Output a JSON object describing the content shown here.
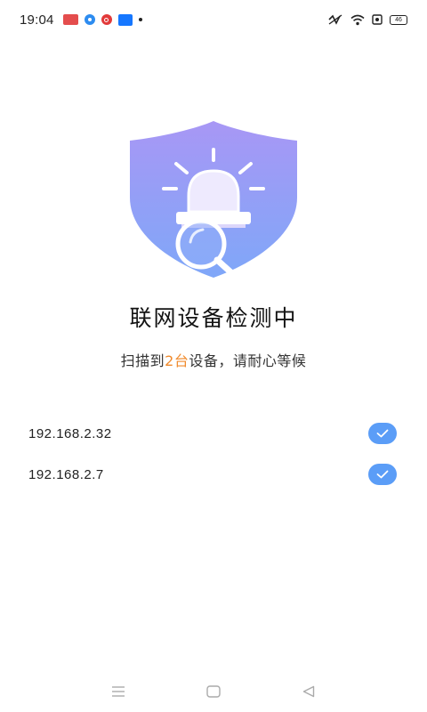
{
  "status_bar": {
    "time": "19:04",
    "notifications": [
      "news-app-icon",
      "browser-app-icon",
      "shield-app-icon",
      "store-app-icon"
    ],
    "battery_level": "46"
  },
  "main": {
    "title": "联网设备检测中",
    "subtitle_prefix": "扫描到",
    "device_count": "2台",
    "subtitle_suffix": "设备，请耐心等候",
    "devices": [
      {
        "ip": "192.168.2.32",
        "status": "checked"
      },
      {
        "ip": "192.168.2.7",
        "status": "checked"
      }
    ]
  },
  "colors": {
    "accent": "#f08a2c",
    "check_bg": "#5b9df7",
    "shield_top": "#a897f5",
    "shield_bottom": "#7fa7f8"
  },
  "nav_bar": {
    "buttons": [
      "menu-icon",
      "home-icon",
      "back-icon"
    ]
  }
}
